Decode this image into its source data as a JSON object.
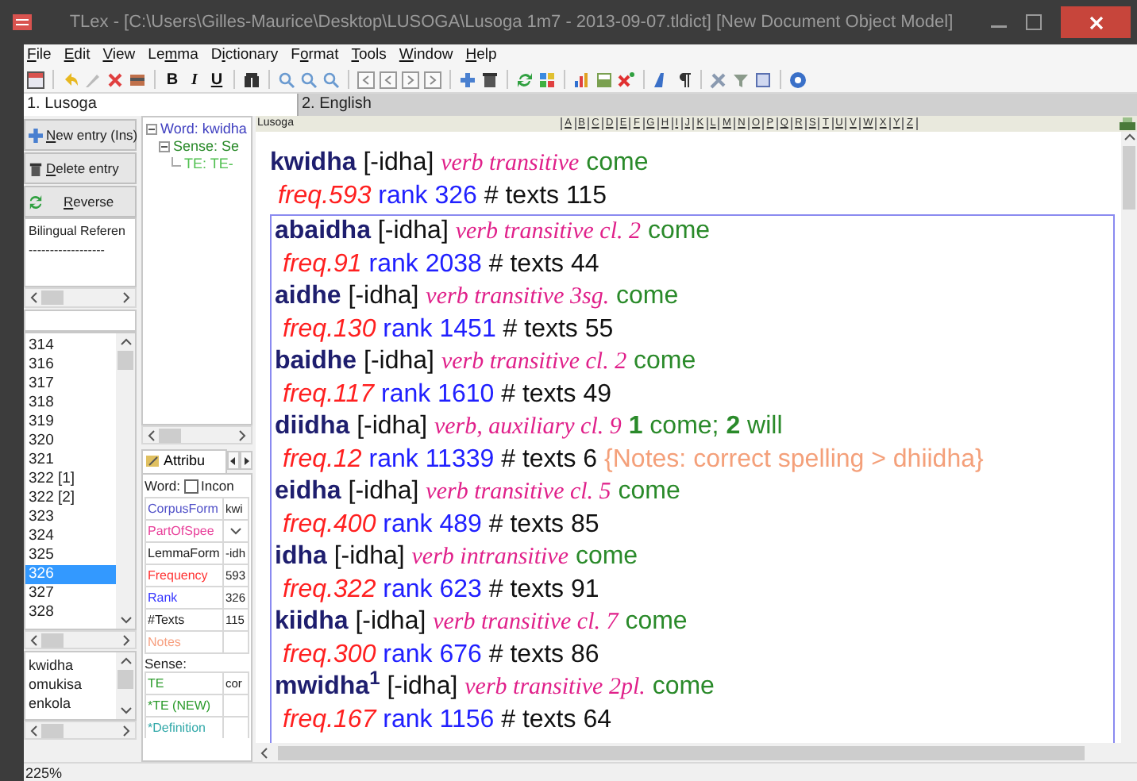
{
  "window": {
    "title": "TLex - [C:\\Users\\Gilles-Maurice\\Desktop\\LUSOGA\\Lusoga 1m7 - 2013-09-07.tldict] [New Document Object Model]"
  },
  "menu": [
    {
      "key": "F",
      "rest": "ile"
    },
    {
      "key": "E",
      "rest": "dit"
    },
    {
      "key": "V",
      "rest": "iew"
    },
    {
      "lead": "Le",
      "key": "m",
      "rest": "ma"
    },
    {
      "lead": "D",
      "key": "i",
      "rest": "ctionary"
    },
    {
      "lead": "F",
      "key": "o",
      "rest": "rmat"
    },
    {
      "key": "T",
      "rest": "ools"
    },
    {
      "key": "W",
      "rest": "indow"
    },
    {
      "key": "H",
      "rest": "elp"
    }
  ],
  "toolbar_text_buttons": [
    "B",
    "I",
    "U"
  ],
  "language_tabs": [
    {
      "label": "1. Lusoga",
      "selected": true
    },
    {
      "label": "2. English",
      "selected": false
    }
  ],
  "actions": [
    {
      "kind": "new",
      "key": "N",
      "rest": "ew entry (Ins)"
    },
    {
      "kind": "delete",
      "key": "D",
      "rest": "elete entry"
    },
    {
      "kind": "reverse",
      "key": "R",
      "rest": "everse"
    }
  ],
  "reference": {
    "title": "Bilingual Referen",
    "rule": "------------------"
  },
  "lemma_list": [
    {
      "label": "314",
      "selected": false
    },
    {
      "label": "316",
      "selected": false
    },
    {
      "label": "317",
      "selected": false
    },
    {
      "label": "318",
      "selected": false
    },
    {
      "label": "319",
      "selected": false
    },
    {
      "label": "320",
      "selected": false
    },
    {
      "label": "321",
      "selected": false
    },
    {
      "label": "322 [1]",
      "selected": false
    },
    {
      "label": "322 [2]",
      "selected": false
    },
    {
      "label": "323",
      "selected": false
    },
    {
      "label": "324",
      "selected": false
    },
    {
      "label": "325",
      "selected": false
    },
    {
      "label": "326",
      "selected": true
    },
    {
      "label": "327",
      "selected": false
    },
    {
      "label": "328",
      "selected": false
    }
  ],
  "word_list": [
    "kwidha",
    "omukisa",
    "enkola"
  ],
  "tree": [
    {
      "label": "Word: kwidha",
      "kind": "word",
      "expanded": true,
      "children": [
        {
          "label": "Sense: Se",
          "kind": "sense",
          "expanded": true,
          "children": [
            {
              "label": "TE: TE-",
              "kind": "te"
            }
          ]
        }
      ]
    }
  ],
  "attributes": {
    "tab": "Attribu",
    "word_label": "Word:",
    "checkbox": {
      "label": "Incon",
      "checked": false
    },
    "word_rows": [
      {
        "label": "CorpusForm",
        "color": "#5050c8",
        "kind": "text",
        "value": "kwi"
      },
      {
        "label": "PartOfSpee",
        "color": "#e8409a",
        "kind": "dropdown"
      },
      {
        "label": "LemmaForm",
        "color": "#202020",
        "kind": "text",
        "value": "-idh"
      },
      {
        "label": "Frequency",
        "color": "#ff3030",
        "kind": "text",
        "value": "593"
      },
      {
        "label": "Rank",
        "color": "#3535ff",
        "kind": "text",
        "value": "326"
      },
      {
        "label": "#Texts",
        "color": "#202020",
        "kind": "text",
        "value": "115"
      },
      {
        "label": "Notes",
        "color": "#f7a080",
        "kind": "text"
      }
    ],
    "sense_label": "Sense:",
    "sense_rows": [
      {
        "label": "TE",
        "color": "#2a9a2a",
        "kind": "text",
        "value": "cor"
      },
      {
        "label": "*TE (NEW)",
        "color": "#2a9a2a",
        "kind": "text"
      },
      {
        "label": "*Definition",
        "color": "#30a8a8",
        "kind": "text"
      }
    ]
  },
  "preview": {
    "language": "Lusoga",
    "alphabet": [
      "A",
      "B",
      "C",
      "D",
      "E",
      "F",
      "G",
      "H",
      "I",
      "J",
      "K",
      "L",
      "M",
      "N",
      "O",
      "P",
      "Q",
      "R",
      "S",
      "T",
      "U",
      "V",
      "W",
      "X",
      "Y",
      "Z"
    ]
  },
  "main_entry": {
    "headword": "kwidha",
    "lemma": "[-idha]",
    "pos": "verb transitive",
    "sense": "come",
    "freq": "freq.593",
    "rank": "rank 326",
    "texts": "# texts 115"
  },
  "entries": [
    {
      "headword": "abaidha",
      "lemma": "[-idha]",
      "pos": "verb transitive cl. 2",
      "sense": "come",
      "freq": "freq.91",
      "rank": "rank 2038",
      "texts": "# texts 44"
    },
    {
      "headword": "aidhe",
      "lemma": "[-idha]",
      "pos": "verb transitive 3sg.",
      "sense": "come",
      "freq": "freq.130",
      "rank": "rank 1451",
      "texts": "# texts 55"
    },
    {
      "headword": "baidhe",
      "lemma": "[-idha]",
      "pos": "verb transitive cl. 2",
      "sense": "come",
      "freq": "freq.117",
      "rank": "rank 1610",
      "texts": "# texts 49"
    },
    {
      "headword": "diidha",
      "lemma": "[-idha]",
      "pos": "verb, auxiliary cl. 9",
      "sense": "**1** come; **2** will",
      "freq": "freq.12",
      "rank": "rank 11339",
      "texts": "# texts 6",
      "notes": "{Notes: correct spelling > dhiidha}"
    },
    {
      "headword": "eidha",
      "lemma": "[-idha]",
      "pos": "verb transitive cl. 5",
      "sense": "come",
      "freq": "freq.400",
      "rank": "rank 489",
      "texts": "# texts 85"
    },
    {
      "headword": "idha",
      "lemma": "[-idha]",
      "pos": "verb intransitive",
      "sense": "come",
      "freq": "freq.322",
      "rank": "rank 623",
      "texts": "# texts 91"
    },
    {
      "headword": "kiidha",
      "lemma": "[-idha]",
      "pos": "verb transitive cl. 7",
      "sense": "come",
      "freq": "freq.300",
      "rank": "rank 676",
      "texts": "# texts 86"
    },
    {
      "headword": "mwidha$^{1}$",
      "lemma": "[-idha]",
      "pos": "verb transitive 2pl.",
      "sense": "come",
      "freq": "freq.167",
      "rank": "rank 1156",
      "texts": "# texts 64"
    }
  ],
  "status_bar": {
    "zoom": "225%"
  }
}
